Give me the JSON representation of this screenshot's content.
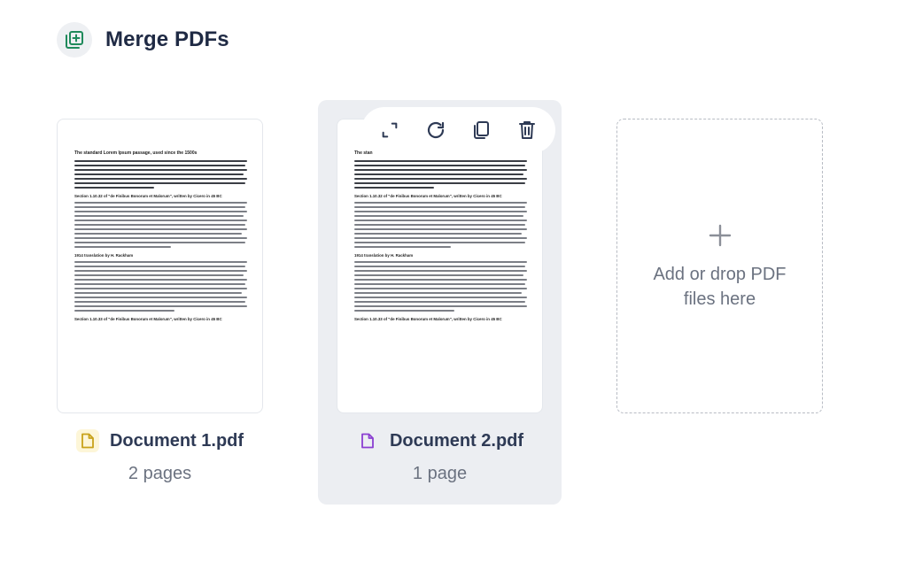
{
  "header": {
    "title": "Merge PDFs",
    "icon": "add-pages-icon",
    "accent": "#1f8a5b"
  },
  "documents": [
    {
      "name": "Document 1.pdf",
      "pages": "2 pages",
      "icon_color": "#c8a21a",
      "icon_bg": "#fdf6d8"
    },
    {
      "name": "Document 2.pdf",
      "pages": "1 page",
      "icon_color": "#8b3fd1",
      "icon_bg": "#eceef2"
    }
  ],
  "preview": {
    "title": "The standard Lorem Ipsum passage, used since the 1500s",
    "title_truncated": "The stan",
    "section1": "Section 1.10.32 of \"de Finibus Bonorum et Malorum\", written by Cicero in 45 BC",
    "section2": "1914 translation by H. Rackham",
    "section3": "Section 1.10.33 of \"de Finibus Bonorum et Malorum\", written by Cicero in 45 BC"
  },
  "toolbar": {
    "buttons": [
      {
        "name": "expand-button",
        "icon": "expand-icon"
      },
      {
        "name": "rotate-button",
        "icon": "rotate-icon"
      },
      {
        "name": "duplicate-button",
        "icon": "copy-icon"
      },
      {
        "name": "delete-button",
        "icon": "trash-icon"
      }
    ]
  },
  "dropzone": {
    "text": "Add or drop PDF files here"
  }
}
